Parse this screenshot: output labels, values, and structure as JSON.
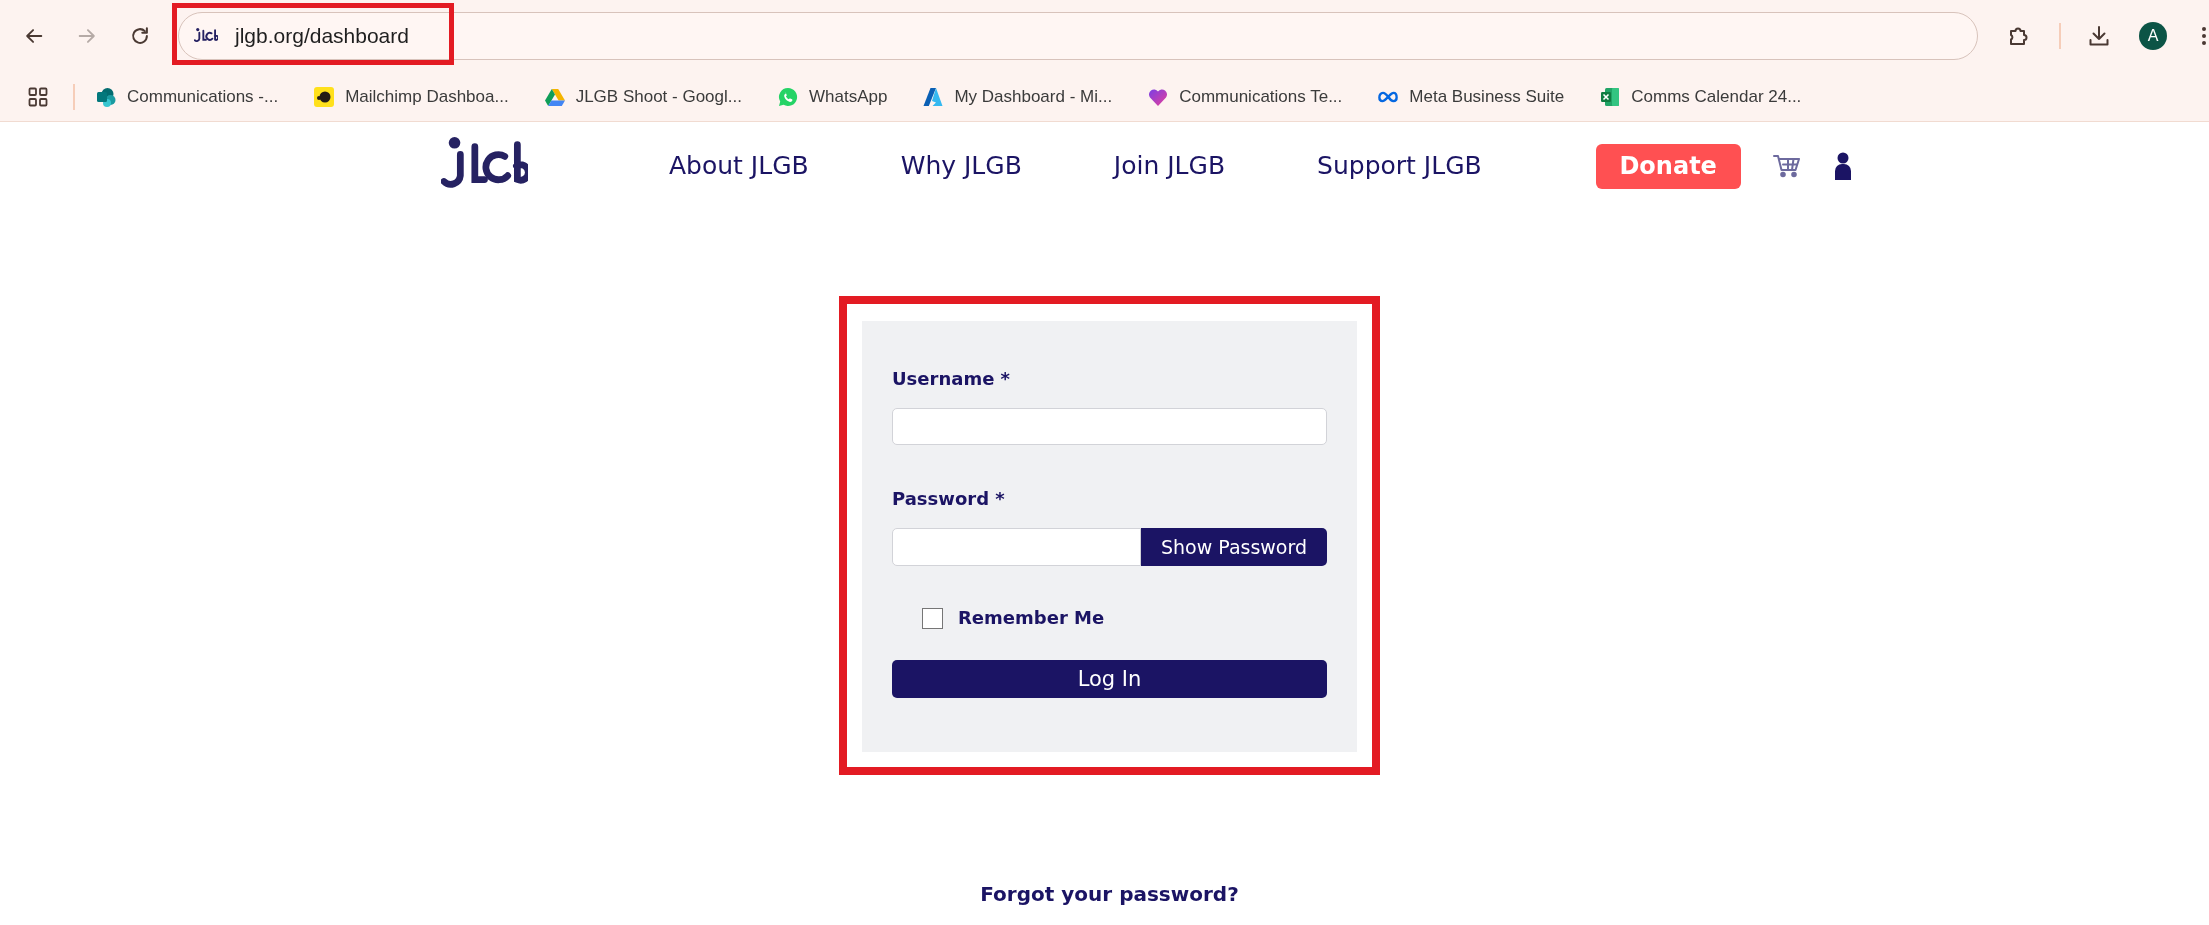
{
  "browser": {
    "nav_buttons": [
      {
        "kind": "back",
        "disabled": false
      },
      {
        "kind": "forward",
        "disabled": true
      },
      {
        "kind": "reload",
        "disabled": false
      }
    ],
    "address_bar": {
      "url": "jlgb.org/dashboard",
      "highlighted": true
    },
    "profile_initial": "A",
    "bookmarks": [
      {
        "label": "Communications -..."
      },
      {
        "label": "Mailchimp Dashboa..."
      },
      {
        "label": "JLGB Shoot - Googl..."
      },
      {
        "label": "WhatsApp"
      },
      {
        "label": "My Dashboard - Mi..."
      },
      {
        "label": "Communications Te..."
      },
      {
        "label": "Meta Business Suite"
      },
      {
        "label": "Comms Calendar 24..."
      }
    ]
  },
  "site_header": {
    "links": [
      "About JLGB",
      "Why JLGB",
      "Join JLGB",
      "Support JLGB"
    ],
    "donate": "Donate"
  },
  "login_form": {
    "highlighted": true,
    "username": {
      "label": "Username *"
    },
    "password": {
      "label": "Password *",
      "toggle": "Show Password"
    },
    "remember_me": {
      "label": "Remember Me",
      "checked": false
    },
    "submit": "Log In"
  },
  "forgot_password": "Forgot your password?"
}
